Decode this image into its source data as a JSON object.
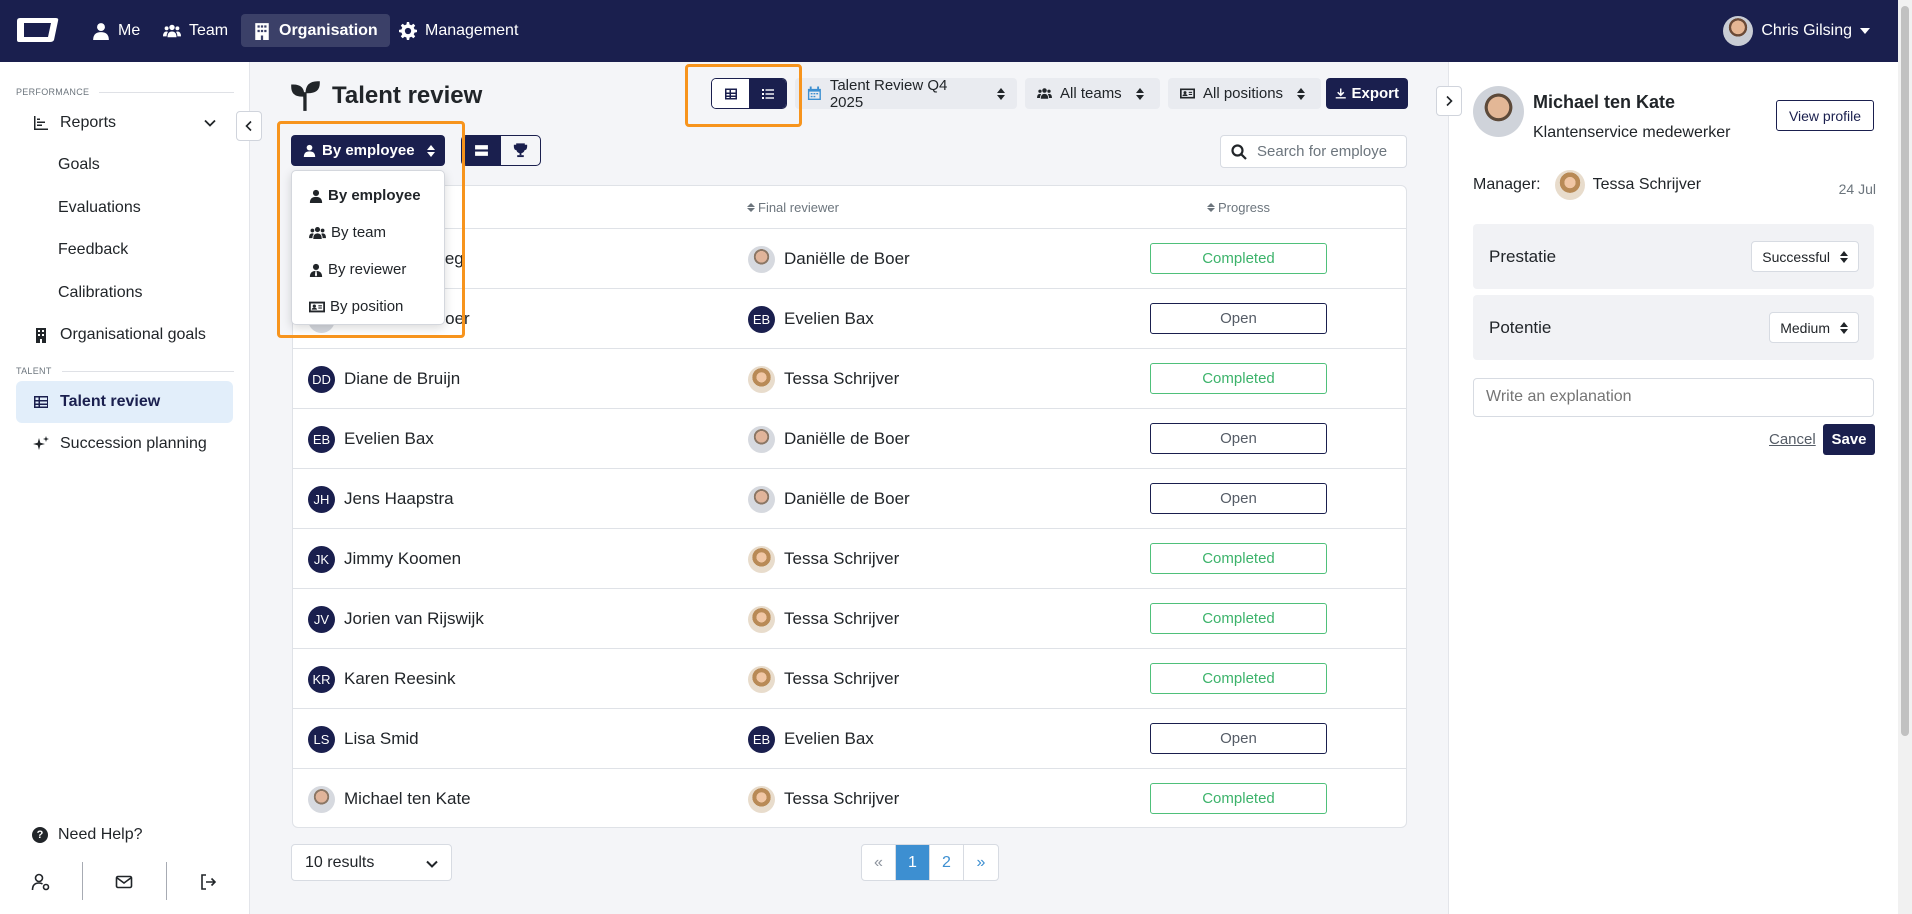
{
  "nav": {
    "items": [
      {
        "label": "Me",
        "icon": "user-icon"
      },
      {
        "label": "Team",
        "icon": "users-icon"
      },
      {
        "label": "Organisation",
        "icon": "building-icon",
        "active": true
      },
      {
        "label": "Management",
        "icon": "gear-icon"
      }
    ],
    "user_name": "Chris Gilsing"
  },
  "sidebar": {
    "performance_label": "PERFORMANCE",
    "talent_label": "TALENT",
    "items": [
      {
        "label": "Reports"
      },
      {
        "label": "Goals"
      },
      {
        "label": "Evaluations"
      },
      {
        "label": "Feedback"
      },
      {
        "label": "Calibrations"
      },
      {
        "label": "Organisational goals"
      },
      {
        "label": "Talent review",
        "active": true
      },
      {
        "label": "Succession planning"
      }
    ],
    "help": "Need Help?"
  },
  "page": {
    "title": "Talent review",
    "review_period": "Talent Review Q4 2025",
    "teams_filter": "All teams",
    "positions_filter": "All positions",
    "export_label": "Export",
    "search_placeholder": "Search for employee",
    "group_by_selected": "By employee",
    "group_by_options": [
      "By employee",
      "By team",
      "By reviewer",
      "By position"
    ],
    "highlight_color": "#f7941d",
    "accent_color": "#1a1f4e"
  },
  "table": {
    "headers": {
      "reviewer": "Final reviewer",
      "progress": "Progress"
    },
    "rows": [
      {
        "employee": "...steeg",
        "employee_avatar": "photo",
        "reviewer": "Daniëlle de Boer",
        "reviewer_avatar": "photo",
        "status": "Completed"
      },
      {
        "employee": "Daniëlle de Boer",
        "employee_avatar": "photo",
        "reviewer": "Evelien Bax",
        "reviewer_avatar": "EB",
        "status": "Open"
      },
      {
        "employee": "Diane de Bruijn",
        "employee_avatar": "DD",
        "reviewer": "Tessa Schrijver",
        "reviewer_avatar": "photo",
        "status": "Completed"
      },
      {
        "employee": "Evelien Bax",
        "employee_avatar": "EB",
        "reviewer": "Daniëlle de Boer",
        "reviewer_avatar": "photo",
        "status": "Open"
      },
      {
        "employee": "Jens Haapstra",
        "employee_avatar": "JH",
        "reviewer": "Daniëlle de Boer",
        "reviewer_avatar": "photo",
        "status": "Open"
      },
      {
        "employee": "Jimmy Koomen",
        "employee_avatar": "JK",
        "reviewer": "Tessa Schrijver",
        "reviewer_avatar": "photo",
        "status": "Completed"
      },
      {
        "employee": "Jorien van Rijswijk",
        "employee_avatar": "JV",
        "reviewer": "Tessa Schrijver",
        "reviewer_avatar": "photo",
        "status": "Completed"
      },
      {
        "employee": "Karen Reesink",
        "employee_avatar": "KR",
        "reviewer": "Tessa Schrijver",
        "reviewer_avatar": "photo",
        "status": "Completed"
      },
      {
        "employee": "Lisa Smid",
        "employee_avatar": "LS",
        "reviewer": "Evelien Bax",
        "reviewer_avatar": "EB",
        "status": "Open"
      },
      {
        "employee": "Michael ten Kate",
        "employee_avatar": "photo",
        "reviewer": "Tessa Schrijver",
        "reviewer_avatar": "photo",
        "status": "Completed"
      }
    ]
  },
  "footer": {
    "results": "10 results",
    "pages": [
      "«",
      "1",
      "2",
      "»"
    ],
    "current_page": "1"
  },
  "panel": {
    "name": "Michael ten Kate",
    "role": "Klantenservice medewerker",
    "view_profile": "View profile",
    "manager_label": "Manager:",
    "manager_name": "Tessa Schrijver",
    "date": "24 Jul",
    "performance_label": "Prestatie",
    "performance_value": "Successful",
    "potential_label": "Potentie",
    "potential_value": "Medium",
    "explanation_placeholder": "Write an explanation",
    "cancel": "Cancel",
    "save": "Save"
  }
}
